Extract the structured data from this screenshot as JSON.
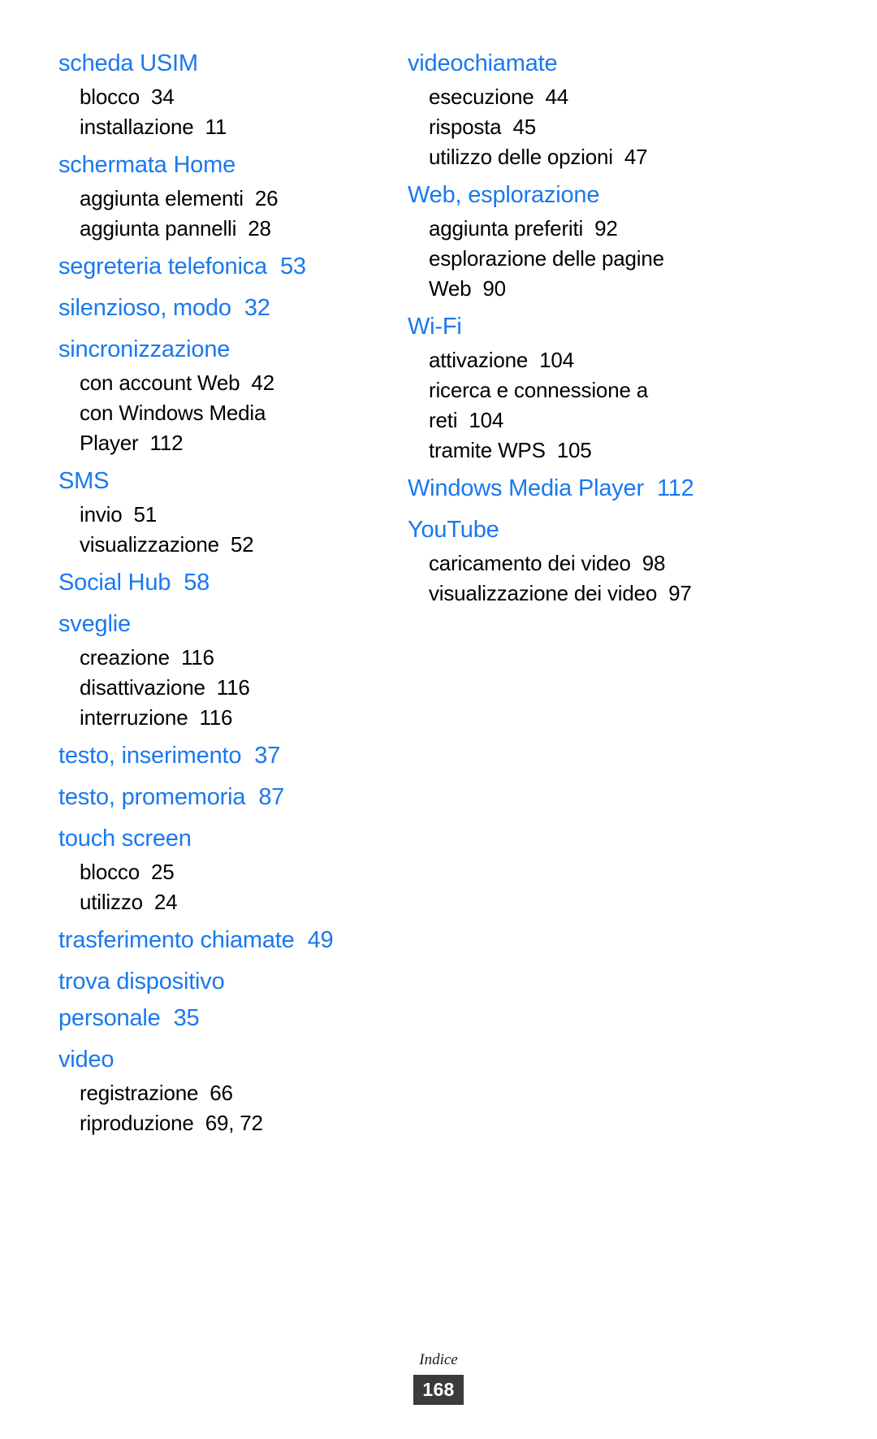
{
  "document": {
    "language": "it",
    "heading_color": "#1a78ef",
    "text_color": "#000000",
    "background_color": "#ffffff"
  },
  "footer": {
    "label": "Indice",
    "page_number": "168",
    "folio_background": "#3b3b3b"
  },
  "columns": [
    {
      "id": "left",
      "entries": [
        {
          "headword": "scheda USIM",
          "page": "",
          "subs": [
            {
              "label": "blocco",
              "page": "34"
            },
            {
              "label": "installazione",
              "page": "11"
            }
          ]
        },
        {
          "headword": "schermata Home",
          "page": "",
          "subs": [
            {
              "label": "aggiunta elementi",
              "page": "26"
            },
            {
              "label": "aggiunta pannelli",
              "page": "28"
            }
          ]
        },
        {
          "headword": "segreteria telefonica",
          "page": "53",
          "subs": []
        },
        {
          "headword": "silenzioso, modo",
          "page": "32",
          "subs": []
        },
        {
          "headword": "sincronizzazione",
          "page": "",
          "subs": [
            {
              "label": "con account Web",
              "page": "42"
            },
            {
              "label": "con Windows Media Player",
              "page": "112"
            }
          ]
        },
        {
          "headword": "SMS",
          "page": "",
          "subs": [
            {
              "label": "invio",
              "page": "51"
            },
            {
              "label": "visualizzazione",
              "page": "52"
            }
          ]
        },
        {
          "headword": "Social Hub",
          "page": "58",
          "subs": []
        },
        {
          "headword": "sveglie",
          "page": "",
          "subs": [
            {
              "label": "creazione",
              "page": "116"
            },
            {
              "label": "disattivazione",
              "page": "116"
            },
            {
              "label": "interruzione",
              "page": "116"
            }
          ]
        },
        {
          "headword": "testo, inserimento",
          "page": "37",
          "subs": []
        },
        {
          "headword": "testo, promemoria",
          "page": "87",
          "subs": []
        },
        {
          "headword": "touch screen",
          "page": "",
          "subs": [
            {
              "label": "blocco",
              "page": "25"
            },
            {
              "label": "utilizzo",
              "page": "24"
            }
          ]
        },
        {
          "headword": "trasferimento chiamate",
          "page": "49",
          "subs": []
        },
        {
          "headword": "trova dispositivo personale",
          "page": "35",
          "subs": []
        },
        {
          "headword": "video",
          "page": "",
          "subs": [
            {
              "label": "registrazione",
              "page": "66"
            },
            {
              "label": "riproduzione",
              "page": "69, 72"
            }
          ]
        }
      ]
    },
    {
      "id": "right",
      "entries": [
        {
          "headword": "videochiamate",
          "page": "",
          "subs": [
            {
              "label": "esecuzione",
              "page": "44"
            },
            {
              "label": "risposta",
              "page": "45"
            },
            {
              "label": "utilizzo delle opzioni",
              "page": "47"
            }
          ]
        },
        {
          "headword": "Web, esplorazione",
          "page": "",
          "subs": [
            {
              "label": "aggiunta preferiti",
              "page": "92"
            },
            {
              "label": "esplorazione delle pagine Web",
              "page": "90"
            }
          ]
        },
        {
          "headword": "Wi-Fi",
          "page": "",
          "subs": [
            {
              "label": "attivazione",
              "page": "104"
            },
            {
              "label": "ricerca e connessione a reti",
              "page": "104"
            },
            {
              "label": "tramite WPS",
              "page": "105"
            }
          ]
        },
        {
          "headword": "Windows Media Player",
          "page": "112",
          "subs": []
        },
        {
          "headword": "YouTube",
          "page": "",
          "subs": [
            {
              "label": "caricamento dei video",
              "page": "98"
            },
            {
              "label": "visualizzazione dei video",
              "page": "97"
            }
          ]
        }
      ]
    }
  ]
}
